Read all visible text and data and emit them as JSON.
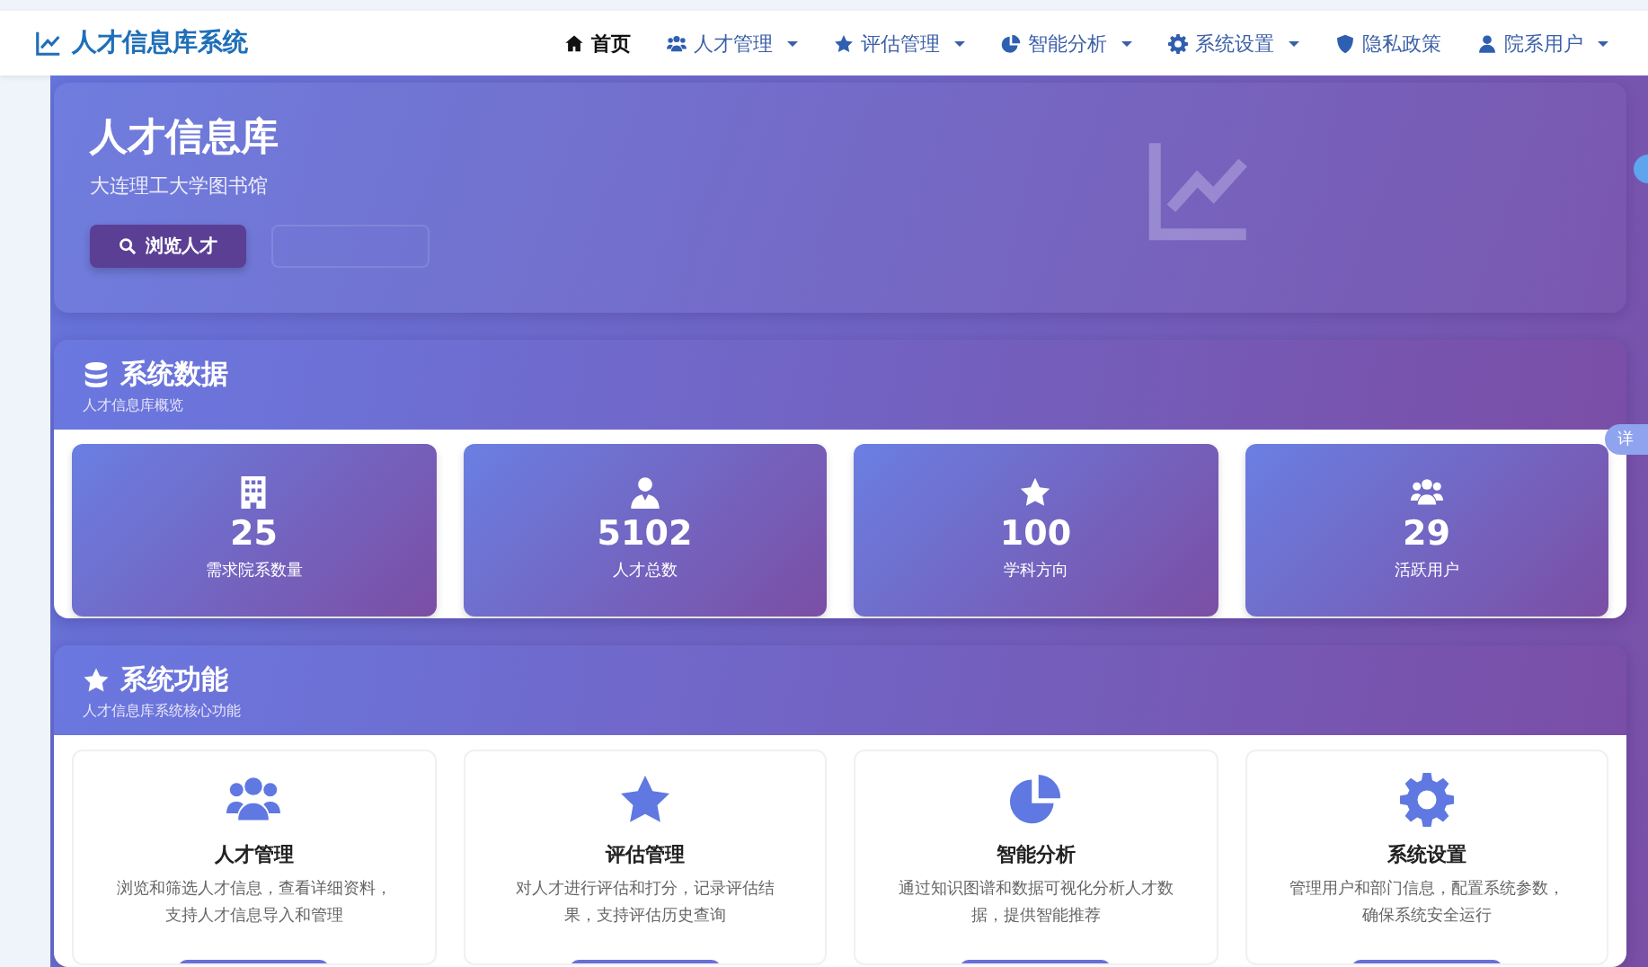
{
  "navbar": {
    "brand": "人才信息库系统",
    "items": [
      {
        "label": "首页",
        "selected": true,
        "dropdown": false
      },
      {
        "label": "人才管理",
        "selected": false,
        "dropdown": true
      },
      {
        "label": "评估管理",
        "selected": false,
        "dropdown": true
      },
      {
        "label": "智能分析",
        "selected": false,
        "dropdown": true
      },
      {
        "label": "系统设置",
        "selected": false,
        "dropdown": true
      },
      {
        "label": "隐私政策",
        "selected": false,
        "dropdown": false
      },
      {
        "label": "院系用户",
        "selected": false,
        "dropdown": true
      }
    ]
  },
  "hero": {
    "title": "人才信息库",
    "subtitle": "大连理工大学图书馆",
    "primary_button": "浏览人才"
  },
  "stats_section": {
    "title": "系统数据",
    "subtitle": "人才信息库概览",
    "items": [
      {
        "value": "25",
        "label": "需求院系数量"
      },
      {
        "value": "5102",
        "label": "人才总数"
      },
      {
        "value": "100",
        "label": "学科方向"
      },
      {
        "value": "29",
        "label": "活跃用户"
      }
    ]
  },
  "features_section": {
    "title": "系统功能",
    "subtitle": "人才信息库系统核心功能",
    "items": [
      {
        "title": "人才管理",
        "description": "浏览和筛选人才信息，查看详细资料，支持人才信息导入和管理"
      },
      {
        "title": "评估管理",
        "description": "对人才进行评估和打分，记录评估结果，支持评估历史查询"
      },
      {
        "title": "智能分析",
        "description": "通过知识图谱和数据可视化分析人才数据，提供智能推荐"
      },
      {
        "title": "系统设置",
        "description": "管理用户和部门信息，配置系统参数，确保系统安全运行"
      }
    ]
  },
  "side_tab": "详"
}
